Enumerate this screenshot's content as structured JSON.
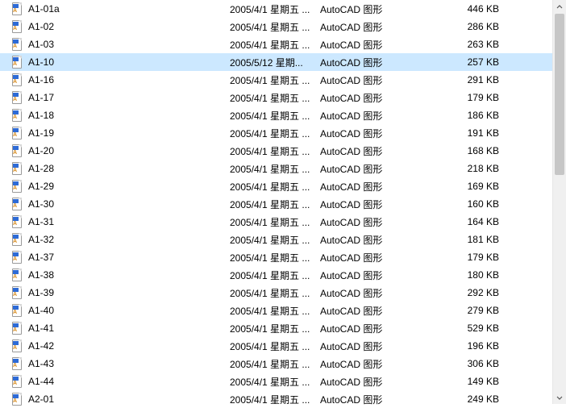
{
  "selected_index": 3,
  "files": [
    {
      "name": "A1-01a",
      "date": "2005/4/1 星期五 ...",
      "type": "AutoCAD 图形",
      "size": "446 KB"
    },
    {
      "name": "A1-02",
      "date": "2005/4/1 星期五 ...",
      "type": "AutoCAD 图形",
      "size": "286 KB"
    },
    {
      "name": "A1-03",
      "date": "2005/4/1 星期五 ...",
      "type": "AutoCAD 图形",
      "size": "263 KB"
    },
    {
      "name": "A1-10",
      "date": "2005/5/12 星期...",
      "type": "AutoCAD 图形",
      "size": "257 KB"
    },
    {
      "name": "A1-16",
      "date": "2005/4/1 星期五 ...",
      "type": "AutoCAD 图形",
      "size": "291 KB"
    },
    {
      "name": "A1-17",
      "date": "2005/4/1 星期五 ...",
      "type": "AutoCAD 图形",
      "size": "179 KB"
    },
    {
      "name": "A1-18",
      "date": "2005/4/1 星期五 ...",
      "type": "AutoCAD 图形",
      "size": "186 KB"
    },
    {
      "name": "A1-19",
      "date": "2005/4/1 星期五 ...",
      "type": "AutoCAD 图形",
      "size": "191 KB"
    },
    {
      "name": "A1-20",
      "date": "2005/4/1 星期五 ...",
      "type": "AutoCAD 图形",
      "size": "168 KB"
    },
    {
      "name": "A1-28",
      "date": "2005/4/1 星期五 ...",
      "type": "AutoCAD 图形",
      "size": "218 KB"
    },
    {
      "name": "A1-29",
      "date": "2005/4/1 星期五 ...",
      "type": "AutoCAD 图形",
      "size": "169 KB"
    },
    {
      "name": "A1-30",
      "date": "2005/4/1 星期五 ...",
      "type": "AutoCAD 图形",
      "size": "160 KB"
    },
    {
      "name": "A1-31",
      "date": "2005/4/1 星期五 ...",
      "type": "AutoCAD 图形",
      "size": "164 KB"
    },
    {
      "name": "A1-32",
      "date": "2005/4/1 星期五 ...",
      "type": "AutoCAD 图形",
      "size": "181 KB"
    },
    {
      "name": "A1-37",
      "date": "2005/4/1 星期五 ...",
      "type": "AutoCAD 图形",
      "size": "179 KB"
    },
    {
      "name": "A1-38",
      "date": "2005/4/1 星期五 ...",
      "type": "AutoCAD 图形",
      "size": "180 KB"
    },
    {
      "name": "A1-39",
      "date": "2005/4/1 星期五 ...",
      "type": "AutoCAD 图形",
      "size": "292 KB"
    },
    {
      "name": "A1-40",
      "date": "2005/4/1 星期五 ...",
      "type": "AutoCAD 图形",
      "size": "279 KB"
    },
    {
      "name": "A1-41",
      "date": "2005/4/1 星期五 ...",
      "type": "AutoCAD 图形",
      "size": "529 KB"
    },
    {
      "name": "A1-42",
      "date": "2005/4/1 星期五 ...",
      "type": "AutoCAD 图形",
      "size": "196 KB"
    },
    {
      "name": "A1-43",
      "date": "2005/4/1 星期五 ...",
      "type": "AutoCAD 图形",
      "size": "306 KB"
    },
    {
      "name": "A1-44",
      "date": "2005/4/1 星期五 ...",
      "type": "AutoCAD 图形",
      "size": "149 KB"
    },
    {
      "name": "A2-01",
      "date": "2005/4/1 星期五 ...",
      "type": "AutoCAD 图形",
      "size": "249 KB"
    }
  ]
}
